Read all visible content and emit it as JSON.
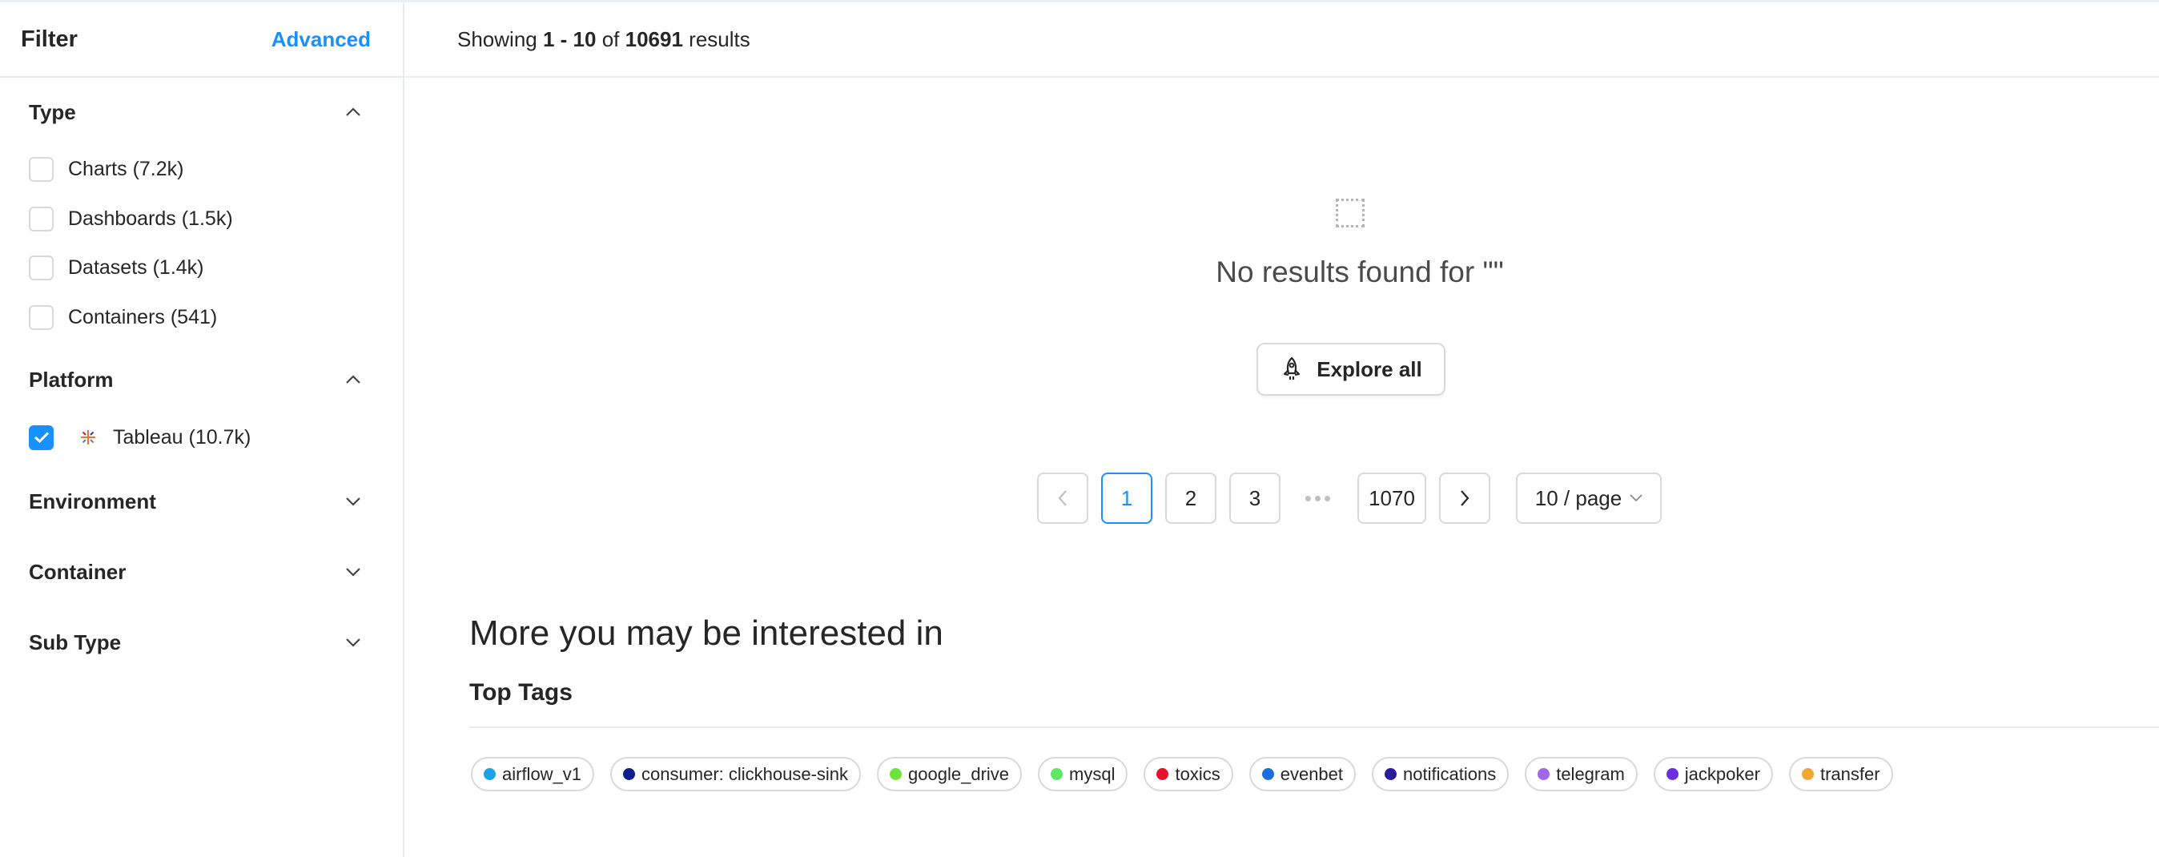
{
  "sidebar": {
    "title": "Filter",
    "advanced_label": "Advanced",
    "sections": {
      "type": {
        "title": "Type",
        "expanded": true,
        "options": [
          {
            "label": "Charts (7.2k)",
            "checked": false
          },
          {
            "label": "Dashboards (1.5k)",
            "checked": false
          },
          {
            "label": "Datasets (1.4k)",
            "checked": false
          },
          {
            "label": "Containers (541)",
            "checked": false
          }
        ]
      },
      "platform": {
        "title": "Platform",
        "expanded": true,
        "options": [
          {
            "label": "Tableau (10.7k)",
            "checked": true,
            "icon": "tableau-icon"
          }
        ]
      },
      "environment": {
        "title": "Environment",
        "expanded": false
      },
      "container": {
        "title": "Container",
        "expanded": false
      },
      "sub_type": {
        "title": "Sub Type",
        "expanded": false
      }
    }
  },
  "results": {
    "prefix": "Showing",
    "range_start": "1",
    "range_sep": " - ",
    "range_end": "10",
    "of": "of",
    "total": "10691",
    "suffix": "results"
  },
  "empty_state": {
    "icon": "empty-placeholder-icon",
    "text": "No results found for \"\"",
    "button_label": "Explore all",
    "button_icon": "rocket-icon"
  },
  "pagination": {
    "prev_icon": "chevron-left-icon",
    "pages": [
      "1",
      "2",
      "3"
    ],
    "active": "1",
    "ellipsis": "•••",
    "last_page": "1070",
    "next_icon": "chevron-right-icon",
    "page_size": "10 / page"
  },
  "recommendations": {
    "title": "More you may be interested in",
    "tags_title": "Top Tags",
    "tags": [
      {
        "label": "airflow_v1",
        "color": "#1aa3e8"
      },
      {
        "label": "consumer: clickhouse-sink",
        "color": "#0d1f8c"
      },
      {
        "label": "google_drive",
        "color": "#6fe33b"
      },
      {
        "label": "mysql",
        "color": "#5ee868"
      },
      {
        "label": "toxics",
        "color": "#e8132a"
      },
      {
        "label": "evenbet",
        "color": "#1a6fe0"
      },
      {
        "label": "notifications",
        "color": "#2b1c9e"
      },
      {
        "label": "telegram",
        "color": "#a266e8"
      },
      {
        "label": "jackpoker",
        "color": "#6a2fe0"
      },
      {
        "label": "transfer",
        "color": "#f0a830"
      }
    ]
  },
  "colors": {
    "accent": "#1890ff",
    "border": "#d9d9d9",
    "text": "#262626"
  }
}
